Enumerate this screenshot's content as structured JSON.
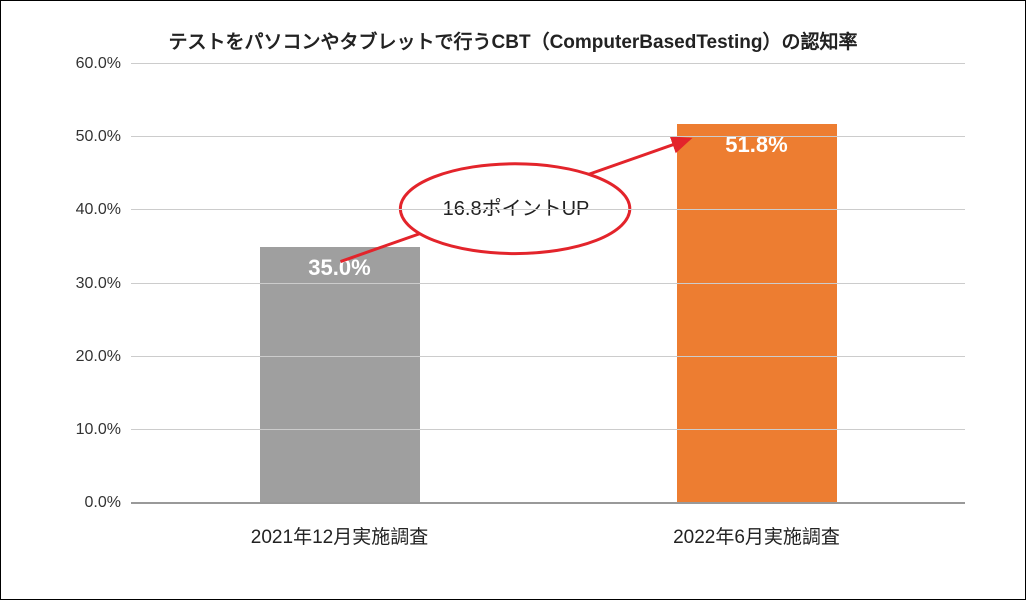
{
  "chart_data": {
    "type": "bar",
    "title": "テストをパソコンやタブレットで行うCBT（ComputerBasedTesting）の認知率",
    "categories": [
      "2021年12月実施調査",
      "2022年6月実施調査"
    ],
    "values": [
      35.0,
      51.8
    ],
    "value_labels": [
      "35.0%",
      "51.8%"
    ],
    "ylim": [
      0,
      60
    ],
    "yticks": [
      0,
      10,
      20,
      30,
      40,
      50,
      60
    ],
    "ytick_labels": [
      "0.0%",
      "10.0%",
      "20.0%",
      "30.0%",
      "40.0%",
      "50.0%",
      "60.0%"
    ],
    "bar_colors": [
      "#9f9f9f",
      "#ed7d31"
    ],
    "annotation": {
      "text": "16.8ポイントUP",
      "color": "#e3242b"
    }
  }
}
